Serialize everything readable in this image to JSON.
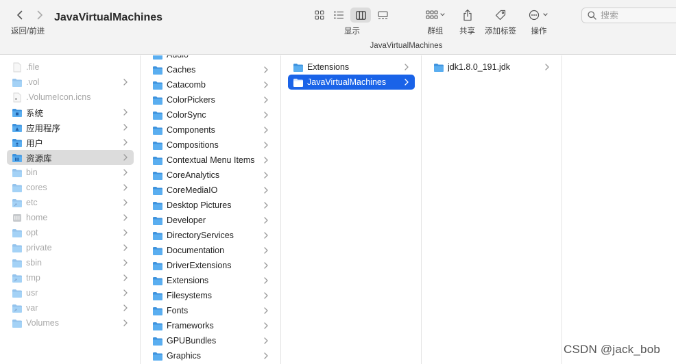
{
  "window": {
    "title": "JavaVirtualMachines",
    "path_label": "JavaVirtualMachines"
  },
  "toolbar": {
    "nav_caption": "返回/前进",
    "view_caption": "显示",
    "group_label": "群组",
    "share_label": "共享",
    "tag_label": "添加标签",
    "action_label": "操作",
    "search_placeholder": "搜索"
  },
  "columns": [
    {
      "items": [
        {
          "label": ".file",
          "icon": "file-icon",
          "dim": true,
          "chevron": false
        },
        {
          "label": ".vol",
          "icon": "folder-icon",
          "dim": true,
          "chevron": true
        },
        {
          "label": ".VolumeIcon.icns",
          "icon": "document-icon",
          "dim": true,
          "chevron": false
        },
        {
          "label": "系统",
          "icon": "system-folder-icon",
          "dim": false,
          "chevron": true
        },
        {
          "label": "应用程序",
          "icon": "applications-folder-icon",
          "dim": false,
          "chevron": true
        },
        {
          "label": "用户",
          "icon": "users-folder-icon",
          "dim": false,
          "chevron": true
        },
        {
          "label": "资源库",
          "icon": "library-folder-icon",
          "dim": false,
          "chevron": true,
          "selected": "gray"
        },
        {
          "label": "bin",
          "icon": "folder-icon",
          "dim": true,
          "chevron": true
        },
        {
          "label": "cores",
          "icon": "folder-icon",
          "dim": true,
          "chevron": true
        },
        {
          "label": "etc",
          "icon": "alias-folder-icon",
          "dim": true,
          "chevron": true
        },
        {
          "label": "home",
          "icon": "server-icon",
          "dim": true,
          "chevron": true
        },
        {
          "label": "opt",
          "icon": "folder-icon",
          "dim": true,
          "chevron": true
        },
        {
          "label": "private",
          "icon": "folder-icon",
          "dim": true,
          "chevron": true
        },
        {
          "label": "sbin",
          "icon": "folder-icon",
          "dim": true,
          "chevron": true
        },
        {
          "label": "tmp",
          "icon": "alias-folder-icon",
          "dim": true,
          "chevron": true
        },
        {
          "label": "usr",
          "icon": "folder-icon",
          "dim": true,
          "chevron": true
        },
        {
          "label": "var",
          "icon": "alias-folder-icon",
          "dim": true,
          "chevron": true
        },
        {
          "label": "Volumes",
          "icon": "folder-icon",
          "dim": true,
          "chevron": true
        }
      ]
    },
    {
      "items": [
        {
          "label": "Audio",
          "icon": "folder-icon",
          "chevron": false,
          "partial": true
        },
        {
          "label": "Caches",
          "icon": "folder-icon",
          "chevron": true
        },
        {
          "label": "Catacomb",
          "icon": "folder-icon",
          "chevron": true
        },
        {
          "label": "ColorPickers",
          "icon": "folder-icon",
          "chevron": true
        },
        {
          "label": "ColorSync",
          "icon": "folder-icon",
          "chevron": true
        },
        {
          "label": "Components",
          "icon": "folder-icon",
          "chevron": true
        },
        {
          "label": "Compositions",
          "icon": "folder-icon",
          "chevron": true
        },
        {
          "label": "Contextual Menu Items",
          "icon": "folder-icon",
          "chevron": true
        },
        {
          "label": "CoreAnalytics",
          "icon": "folder-icon",
          "chevron": true
        },
        {
          "label": "CoreMediaIO",
          "icon": "folder-icon",
          "chevron": true
        },
        {
          "label": "Desktop Pictures",
          "icon": "folder-icon",
          "chevron": true
        },
        {
          "label": "Developer",
          "icon": "folder-icon",
          "chevron": true
        },
        {
          "label": "DirectoryServices",
          "icon": "folder-icon",
          "chevron": true
        },
        {
          "label": "Documentation",
          "icon": "folder-icon",
          "chevron": true
        },
        {
          "label": "DriverExtensions",
          "icon": "folder-icon",
          "chevron": true
        },
        {
          "label": "Extensions",
          "icon": "folder-icon",
          "chevron": true
        },
        {
          "label": "Filesystems",
          "icon": "folder-icon",
          "chevron": true
        },
        {
          "label": "Fonts",
          "icon": "folder-icon",
          "chevron": true
        },
        {
          "label": "Frameworks",
          "icon": "folder-icon",
          "chevron": true
        },
        {
          "label": "GPUBundles",
          "icon": "folder-icon",
          "chevron": true
        },
        {
          "label": "Graphics",
          "icon": "folder-icon",
          "chevron": true
        }
      ]
    },
    {
      "items": [
        {
          "label": "Extensions",
          "icon": "folder-icon",
          "chevron": true
        },
        {
          "label": "JavaVirtualMachines",
          "icon": "folder-icon",
          "chevron": true,
          "selected": "blue"
        }
      ]
    },
    {
      "items": [
        {
          "label": "jdk1.8.0_191.jdk",
          "icon": "folder-icon",
          "chevron": true
        }
      ]
    }
  ],
  "watermark": "CSDN @jack_bob",
  "colors": {
    "accent": "#1a63e8",
    "folder": "#5aaef0",
    "selection_gray": "#dcdcdc"
  }
}
